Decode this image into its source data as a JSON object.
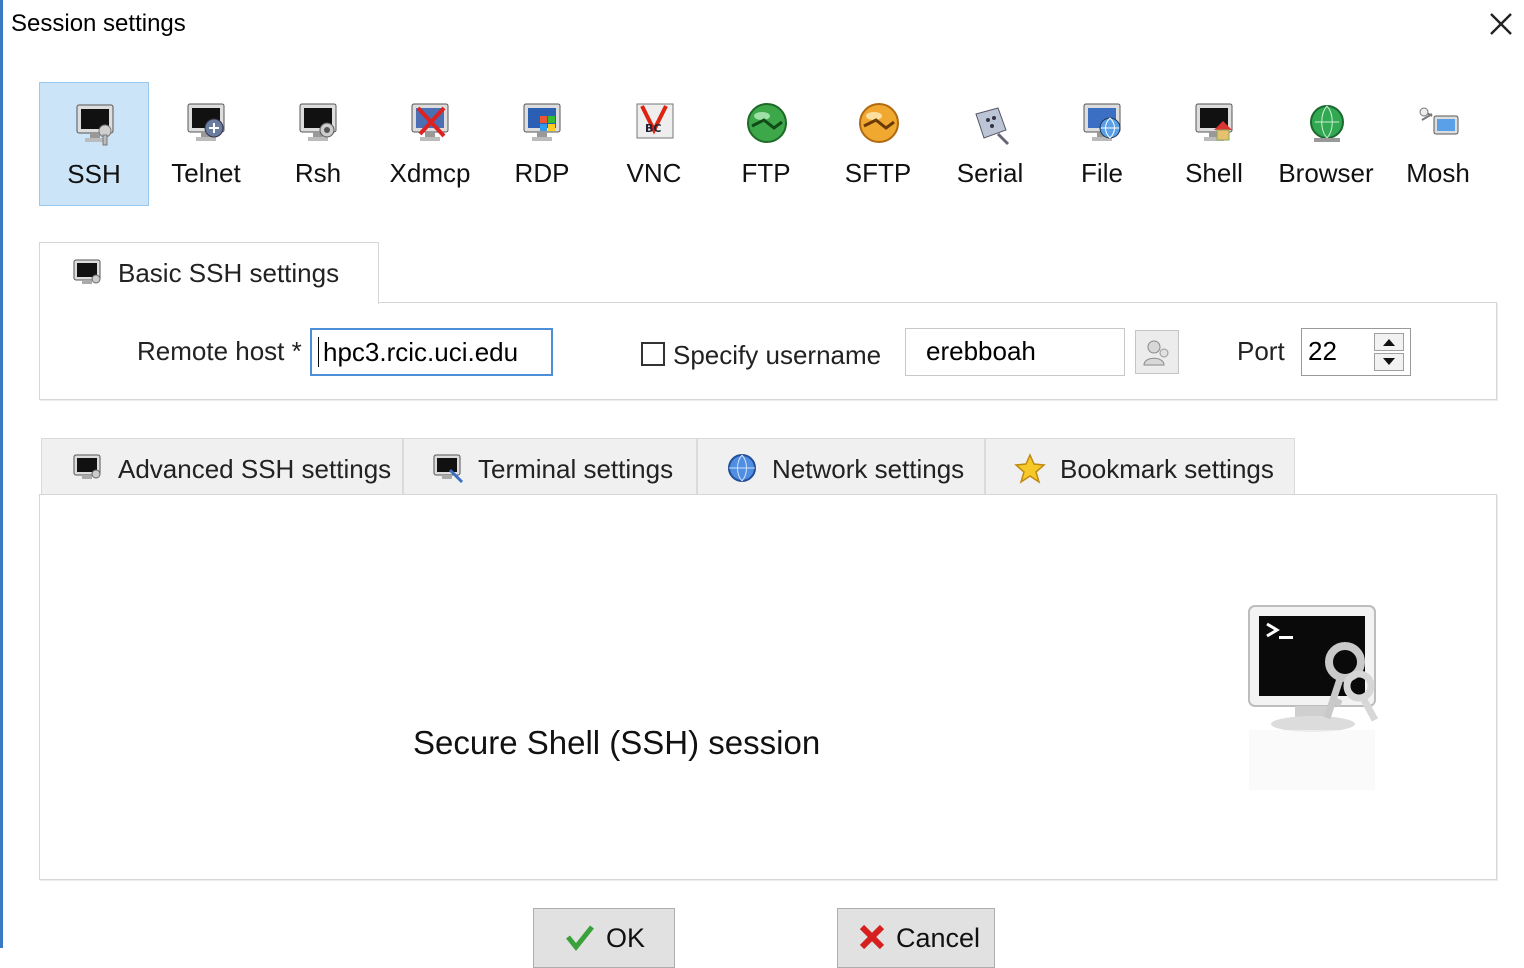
{
  "window": {
    "title": "Session settings"
  },
  "session_types": [
    {
      "label": "SSH",
      "icon": "ssh-icon",
      "active": true
    },
    {
      "label": "Telnet",
      "icon": "telnet-icon"
    },
    {
      "label": "Rsh",
      "icon": "rsh-icon"
    },
    {
      "label": "Xdmcp",
      "icon": "xdmcp-icon"
    },
    {
      "label": "RDP",
      "icon": "rdp-icon"
    },
    {
      "label": "VNC",
      "icon": "vnc-icon"
    },
    {
      "label": "FTP",
      "icon": "ftp-icon"
    },
    {
      "label": "SFTP",
      "icon": "sftp-icon"
    },
    {
      "label": "Serial",
      "icon": "serial-icon"
    },
    {
      "label": "File",
      "icon": "file-icon"
    },
    {
      "label": "Shell",
      "icon": "shell-icon"
    },
    {
      "label": "Browser",
      "icon": "browser-icon"
    },
    {
      "label": "Mosh",
      "icon": "mosh-icon"
    }
  ],
  "basic": {
    "tab_label": "Basic SSH settings",
    "remote_host_label": "Remote host *",
    "remote_host_value": "hpc3.rcic.uci.edu",
    "specify_username_label": "Specify username",
    "specify_username_checked": false,
    "username_value": "erebboah",
    "port_label": "Port",
    "port_value": "22"
  },
  "advanced_tabs": [
    {
      "label": "Advanced SSH settings",
      "icon": "terminal-icon"
    },
    {
      "label": "Terminal settings",
      "icon": "terminal-settings-icon"
    },
    {
      "label": "Network settings",
      "icon": "globe-icon"
    },
    {
      "label": "Bookmark settings",
      "icon": "star-icon"
    }
  ],
  "content": {
    "description": "Secure Shell (SSH) session",
    "icon": "ssh-keys-icon"
  },
  "buttons": {
    "ok": "OK",
    "cancel": "Cancel"
  },
  "colors": {
    "active_tab_bg": "#cce4f7",
    "focus_border": "#4b8fd8",
    "window_accent": "#3b78c4"
  }
}
